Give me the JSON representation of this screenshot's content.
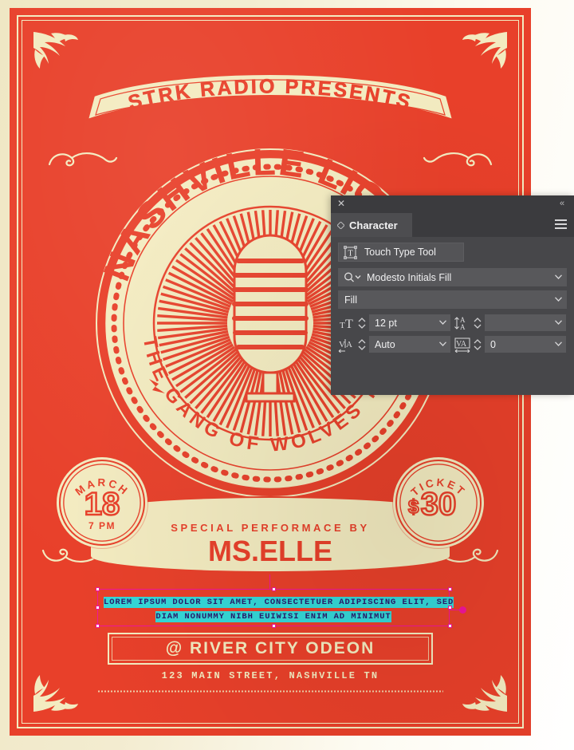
{
  "poster": {
    "colors": {
      "red": "#e8402a",
      "cream": "#f3ebc0",
      "canvas": "#efe7c4"
    },
    "ribbon_text": "STRK RADIO PRESENTS",
    "seal": {
      "arc_top": "NASHVILLE LIGHTS",
      "arc_bottom": "THE GANG OF WOLVES TOUR",
      "center_icon": "vintage-microphone-icon"
    },
    "date_badge": {
      "arc_label": "MARCH",
      "day": "18",
      "time": "7 PM"
    },
    "ticket_badge": {
      "arc_label": "TICKET",
      "currency": "$",
      "price": "30"
    },
    "performer": {
      "label": "SPECIAL PERFORMACE BY",
      "name": "MS.ELLE"
    },
    "body_text": {
      "line1": "LOREM IPSUM DOLOR SIT AMET, CONSECTETUER ADIPISCING ELIT, SED",
      "line2": "DIAM NONUMMY NIBH EUIWISI ENIM AD MINIMUT",
      "selection_color": "#35d8d8",
      "bbox_color": "#f0159b"
    },
    "venue": {
      "name": "@ RIVER CITY ODEON",
      "address": "123 MAIN STREET, NASHVILLE TN"
    }
  },
  "character_panel": {
    "title": "Character",
    "close_icon": "close-icon",
    "collapse_icon": "double-chevron-left-icon",
    "menu_icon": "hamburger-menu-icon",
    "tab_icon": "diamond-icon",
    "touch_type_tool": {
      "label": "Touch Type Tool",
      "icon": "touch-type-tool-icon"
    },
    "font_family": {
      "value": "Modesto Initials Fill",
      "icon": "search-icon"
    },
    "font_style": {
      "value": "Fill"
    },
    "font_size": {
      "value": "12 pt",
      "icon": "font-size-icon"
    },
    "leading": {
      "value": "",
      "icon": "leading-icon"
    },
    "kerning": {
      "value": "Auto",
      "icon": "kerning-icon"
    },
    "tracking": {
      "value": "0",
      "icon": "tracking-icon"
    }
  }
}
